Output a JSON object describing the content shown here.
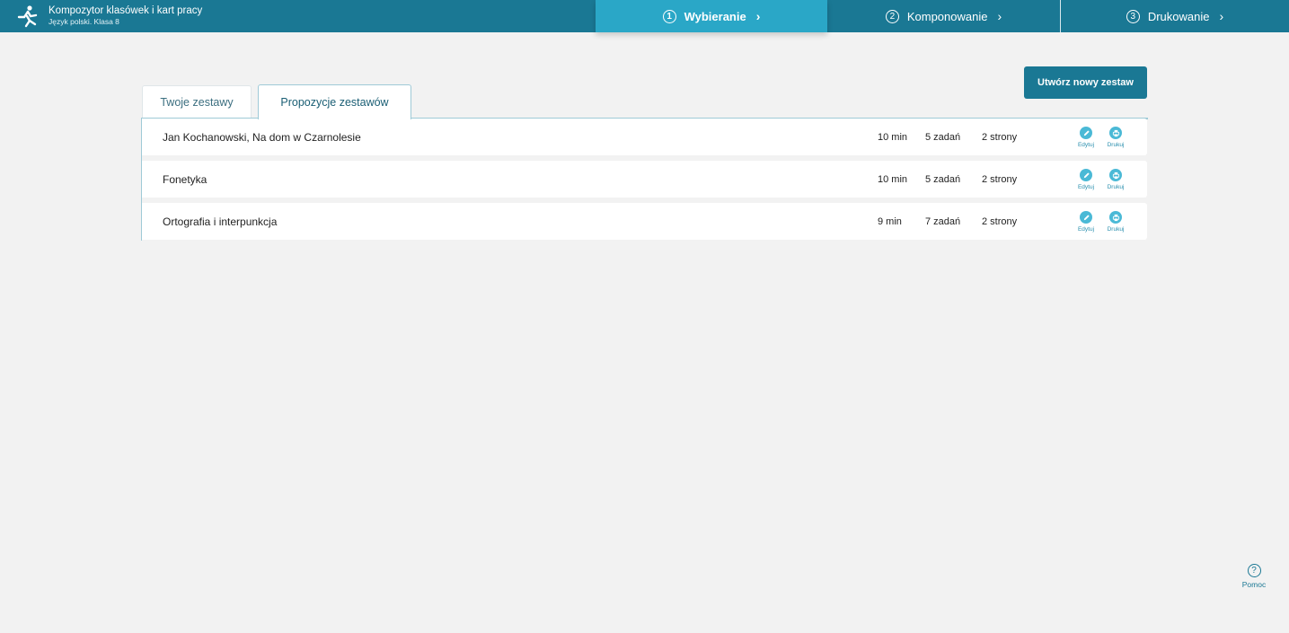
{
  "header": {
    "app_title": "Kompozytor klasówek i kart pracy",
    "app_subtitle": "Język polski. Klasa 8",
    "logo_icon": "running-figure-icon",
    "steps": [
      {
        "num": "1",
        "label": "Wybieranie",
        "active": true
      },
      {
        "num": "2",
        "label": "Komponowanie",
        "active": false
      },
      {
        "num": "3",
        "label": "Drukowanie",
        "active": false
      }
    ]
  },
  "actions": {
    "create_label": "Utwórz nowy zestaw"
  },
  "tabs": [
    {
      "label": "Twoje zestawy",
      "active": false
    },
    {
      "label": "Propozycje zestawów",
      "active": true
    }
  ],
  "sets": [
    {
      "name": "Jan Kochanowski, Na dom w Czarnolesie",
      "time": "10 min",
      "tasks": "5 zadań",
      "pages": "2 strony",
      "edit_label": "Edytuj",
      "print_label": "Drukuj"
    },
    {
      "name": "Fonetyka",
      "time": "10 min",
      "tasks": "5 zadań",
      "pages": "2 strony",
      "edit_label": "Edytuj",
      "print_label": "Drukuj"
    },
    {
      "name": "Ortografia i interpunkcja",
      "time": "9 min",
      "tasks": "7 zadań",
      "pages": "2 strony",
      "edit_label": "Edytuj",
      "print_label": "Drukuj"
    }
  ],
  "help": {
    "icon": "?",
    "label": "Pomoc"
  },
  "colors": {
    "header": "#1a7894",
    "active_step": "#2aa7c7",
    "accent_icon": "#4ab9d6"
  }
}
